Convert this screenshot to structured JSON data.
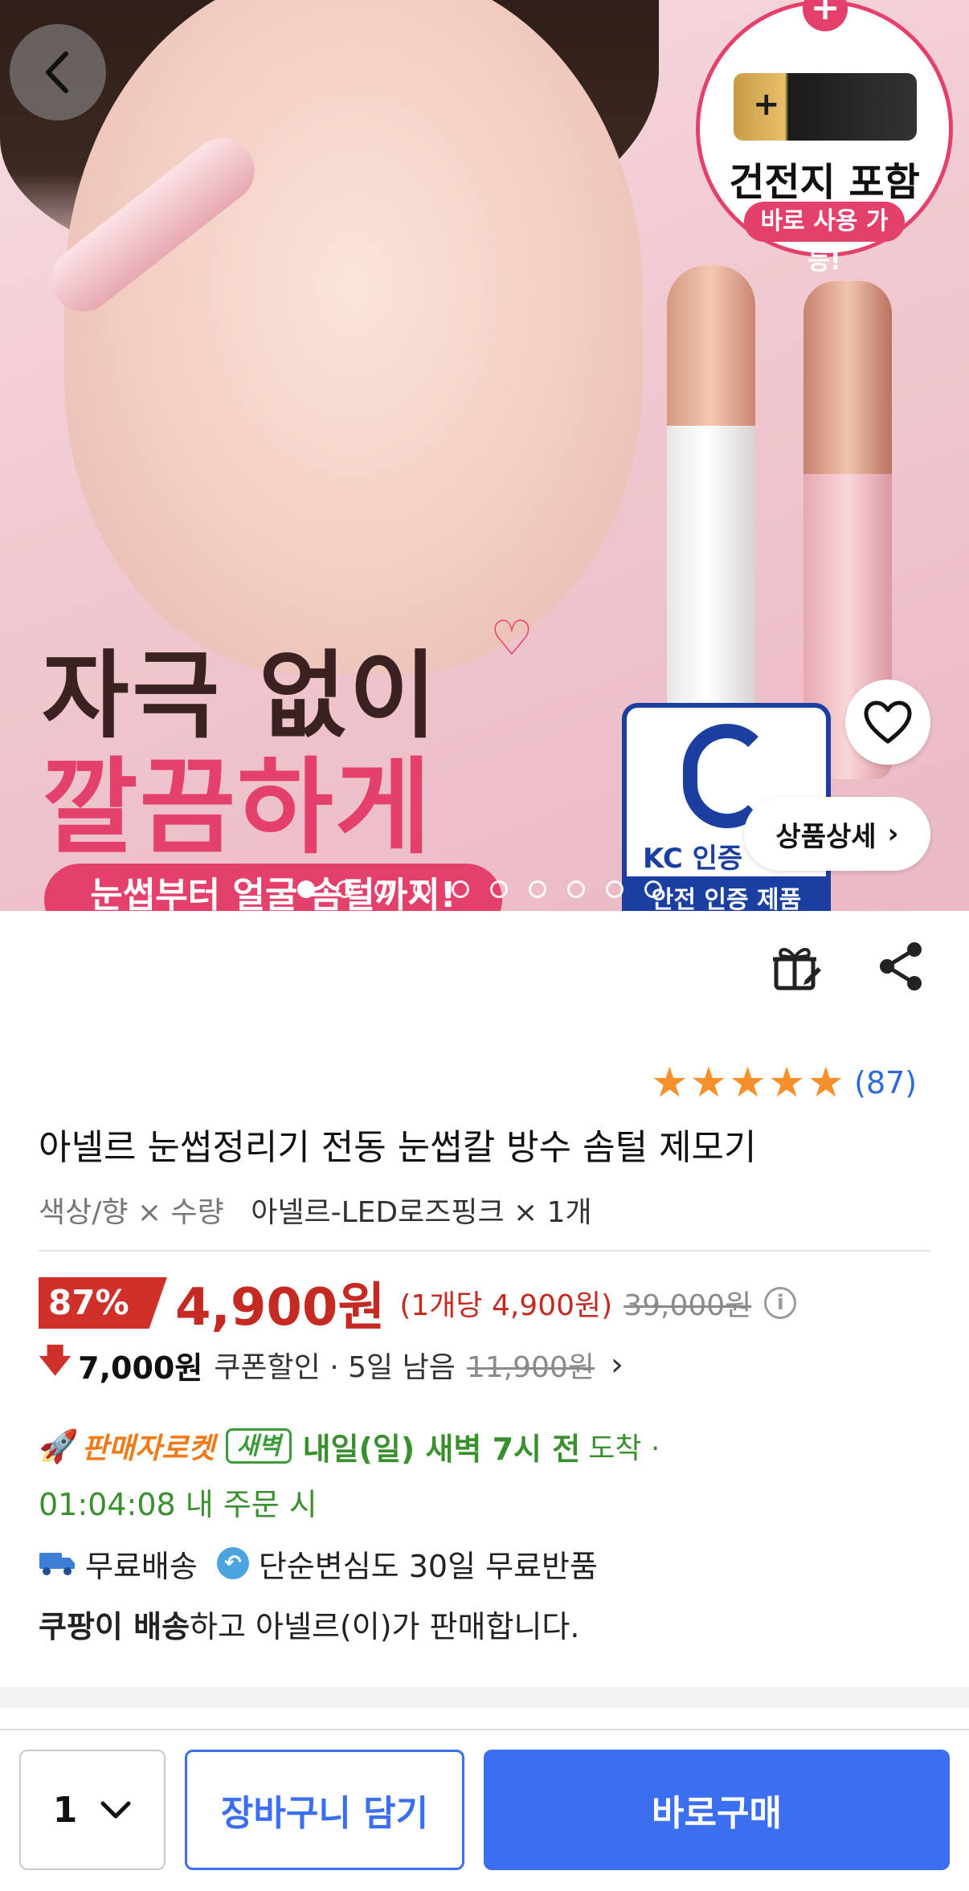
{
  "hero": {
    "battery_title": "건전지 포함",
    "battery_sub": "바로 사용 가능!",
    "battery_plus": "+",
    "headline_line1": "자극 없이",
    "headline_line2": "깔끔하게",
    "subline": "눈썹부터 얼굴 솜털까지!",
    "kc_label": "KC 인증",
    "kc_sub": "안전 인증 제품",
    "detail_button": "상품상세",
    "slide_count": 10,
    "active_slide": 1
  },
  "product": {
    "rating_stars": 5,
    "review_count": "(87)",
    "title": "아넬르 눈썹정리기 전동 눈썹칼 방수 솜털 제모기",
    "option_key": "색상/향 × 수량",
    "option_value": "아넬르-LED로즈핑크 × 1개"
  },
  "price": {
    "discount": "87%",
    "sale_price": "4,900원",
    "unit_price": "(1개당 4,900원)",
    "original_price": "39,000원",
    "info_icon": "i",
    "coupon_amount": "7,000원",
    "coupon_text": "쿠폰할인 · 5일 남음",
    "coupon_original": "11,900원"
  },
  "delivery": {
    "seller_rocket": "판매자로켓",
    "dawn_badge": "새벽",
    "arrival_bold": "내일(일) 새벽 7시 전",
    "arrival_rest": "도착 ·",
    "order_deadline": "01:04:08 내 주문 시",
    "free_shipping": "무료배송",
    "free_return": "단순변심도 30일 무료반품",
    "seller_prefix": "쿠팡이 배송",
    "seller_suffix": "하고 아넬르(이)가 판매합니다."
  },
  "bottom_bar": {
    "quantity": "1",
    "cart_button": "장바구니 담기",
    "buy_button": "바로구매"
  },
  "colors": {
    "accent_blue": "#3c6ef0",
    "price_red": "#c42a22",
    "delivery_green": "#3a8f2e",
    "rocket_orange": "#f07a1a",
    "star_orange": "#f5902a",
    "brand_pink": "#e3416b"
  }
}
